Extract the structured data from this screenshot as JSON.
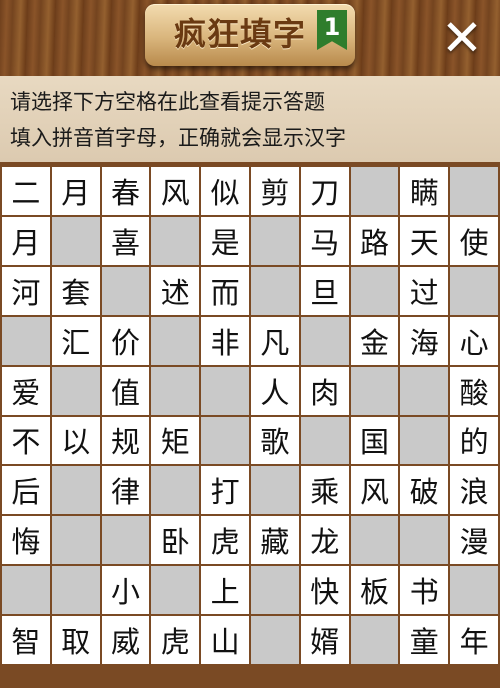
{
  "header": {
    "title": "疯狂填字",
    "level": "1",
    "close_label": "✕"
  },
  "hint": {
    "line1": "请选择下方空格在此查看提示答题",
    "line2": "填入拼音首字母，正确就会显示汉字"
  },
  "grid": [
    [
      "二",
      "月",
      "春",
      "风",
      "似",
      "剪",
      "刀",
      "",
      "瞒",
      ""
    ],
    [
      "月",
      "",
      "喜",
      "",
      "是",
      "",
      "马",
      "路",
      "天",
      "使"
    ],
    [
      "河",
      "套",
      "",
      "述",
      "而",
      "",
      "旦",
      "",
      "过",
      ""
    ],
    [
      "",
      "汇",
      "价",
      "",
      "非",
      "凡",
      "",
      "金",
      "海",
      "心"
    ],
    [
      "爱",
      "",
      "值",
      "",
      "",
      "人",
      "肉",
      "",
      "",
      "酸"
    ],
    [
      "不",
      "以",
      "规",
      "矩",
      "",
      "歌",
      "",
      "国",
      "",
      "的"
    ],
    [
      "后",
      "",
      "律",
      "",
      "打",
      "",
      "乘",
      "风",
      "破",
      "浪"
    ],
    [
      "悔",
      "",
      "",
      "卧",
      "虎",
      "藏",
      "龙",
      "",
      "",
      "漫"
    ],
    [
      "",
      "",
      "小",
      "",
      "上",
      "",
      "快",
      "板",
      "书",
      ""
    ],
    [
      "智",
      "取",
      "威",
      "虎",
      "山",
      "",
      "婿",
      "",
      "童",
      "年"
    ]
  ],
  "colors": {
    "wood": "#7a4a24",
    "hint_bg": "#e8d9c1",
    "empty_cell": "#c9c9c9",
    "badge": "#2f7d2c"
  }
}
